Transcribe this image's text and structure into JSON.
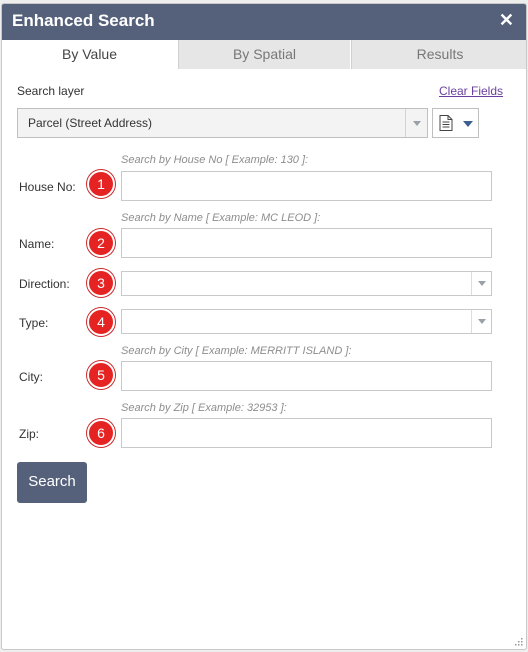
{
  "window": {
    "title": "Enhanced Search",
    "close_icon": "✕"
  },
  "tabs": [
    {
      "label": "By Value",
      "active": true
    },
    {
      "label": "By Spatial",
      "active": false
    },
    {
      "label": "Results",
      "active": false
    }
  ],
  "search_layer": {
    "label": "Search layer",
    "clear_fields": "Clear Fields",
    "selected": "Parcel (Street Address)"
  },
  "fields": [
    {
      "label": "House No:",
      "hint": "Search by House No [ Example: 130 ]:",
      "value": "",
      "marker": "1"
    },
    {
      "label": "Name:",
      "hint": "Search by Name [ Example: MC LEOD ]:",
      "value": "",
      "marker": "2"
    },
    {
      "label": "Direction:",
      "value": "",
      "marker": "3"
    },
    {
      "label": "Type:",
      "value": "",
      "marker": "4"
    },
    {
      "label": "City:",
      "hint": "Search by City [ Example: MERRITT ISLAND ]:",
      "value": "",
      "marker": "5"
    },
    {
      "label": "Zip:",
      "hint": "Search by Zip [ Example: 32953 ]:",
      "value": "",
      "marker": "6"
    }
  ],
  "search_button": "Search",
  "colors": {
    "header": "#55617a",
    "badge": "#e52322",
    "link": "#6a3fa0"
  }
}
